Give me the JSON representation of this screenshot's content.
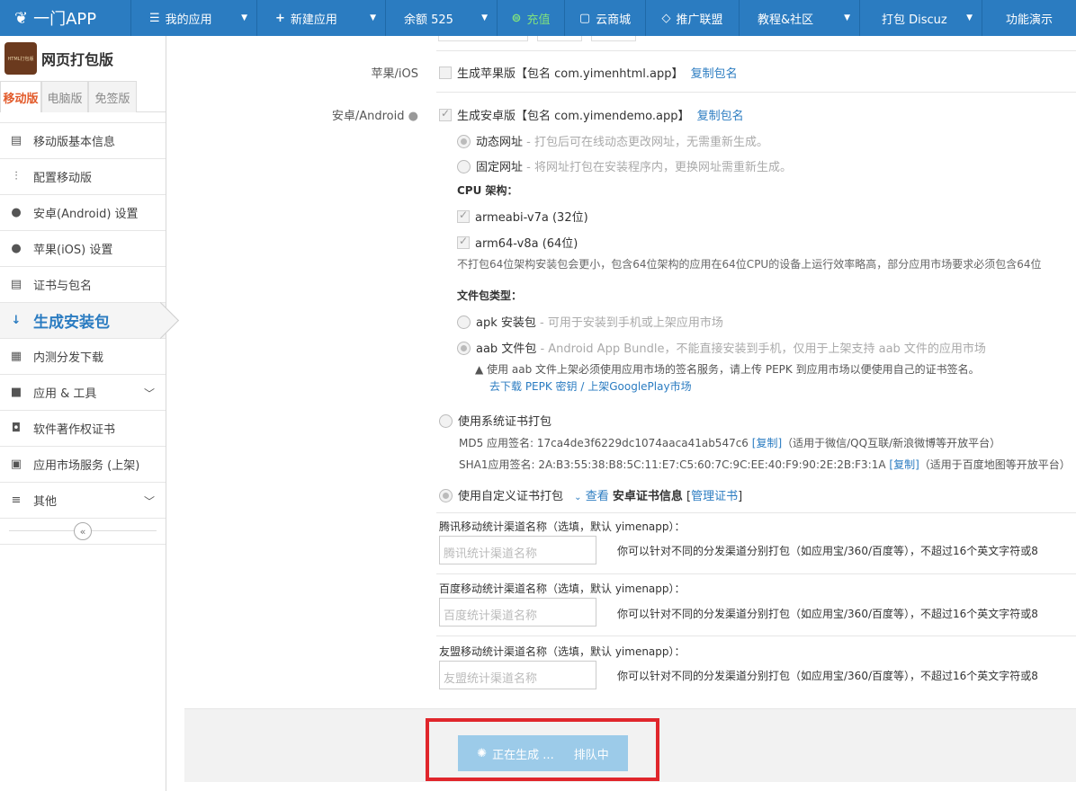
{
  "topbar": {
    "brand": "一门APP",
    "items": [
      {
        "label": "我的应用",
        "icon": "☰",
        "caret": true
      },
      {
        "label": "新建应用",
        "icon": "+",
        "caret": true
      },
      {
        "label": "余额 525",
        "icon": "",
        "caret": true
      },
      {
        "label": "充值",
        "icon": "⊜",
        "caret": false
      },
      {
        "label": "云商城",
        "icon": "▢",
        "caret": false
      },
      {
        "label": "推广联盟",
        "icon": "◇",
        "caret": false
      },
      {
        "label": "教程&社区",
        "icon": "",
        "caret": true
      },
      {
        "label": "打包 Discuz",
        "icon": "",
        "caret": true
      },
      {
        "label": "功能演示",
        "icon": "",
        "caret": false
      }
    ]
  },
  "sidebar": {
    "app_icon_text": "HTML打包版",
    "app_name": "网页打包版",
    "tabs": [
      "移动版",
      "电脑版",
      "免签版"
    ],
    "items": [
      {
        "label": "移动版基本信息",
        "icon": "▤"
      },
      {
        "label": "配置移动版",
        "icon": "⫶"
      },
      {
        "label": "安卓(Android) 设置",
        "icon": "●"
      },
      {
        "label": "苹果(iOS) 设置",
        "icon": ""
      },
      {
        "label": "证书与包名",
        "icon": "▤"
      },
      {
        "label": "生成安装包",
        "icon": "↓"
      },
      {
        "label": "内测分发下载",
        "icon": "▦"
      },
      {
        "label": "应用 & 工具",
        "icon": "■"
      },
      {
        "label": "软件著作权证书",
        "icon": "◘"
      },
      {
        "label": "应用市场服务 (上架)",
        "icon": "▣"
      },
      {
        "label": "其他",
        "icon": "≡"
      }
    ],
    "collapse": "«"
  },
  "main": {
    "ios_label": "苹果/iOS",
    "ios_checkbox": "生成苹果版【包名 com.yimenhtml.app】",
    "ios_copy": "复制包名",
    "android_label": "安卓/Android",
    "android_checkbox": "生成安卓版【包名 com.yimendemo.app】",
    "android_copy": "复制包名",
    "url_dynamic": "动态网址",
    "url_dynamic_hint": " - 打包后可在线动态更改网址，无需重新生成。",
    "url_fixed": "固定网址",
    "url_fixed_hint": " - 将网址打包在安装程序内，更换网址需重新生成。",
    "cpu_title": "CPU 架构：",
    "cpu1": "armeabi-v7a (32位)",
    "cpu2": "arm64-v8a (64位)",
    "cpu_note": "不打包64位架构安装包会更小，包含64位架构的应用在64位CPU的设备上运行效率略高，部分应用市场要求必须包含64位",
    "file_title": "文件包类型：",
    "apk": "apk 安装包",
    "apk_hint": " - 可用于安装到手机或上架应用市场",
    "aab": "aab 文件包",
    "aab_hint": " - Android App Bundle，不能直接安装到手机，仅用于上架支持 aab 文件的应用市场",
    "aab_warning": "使用 aab 文件上架必须使用应用市场的签名服务，请上传 PEPK 到应用市场以便使用自己的证书签名。",
    "pepk_link": "去下载 PEPK 密钥",
    "slash": " / ",
    "gplay_link": "上架GooglePlay市场",
    "sys_cert": "使用系统证书打包",
    "md5_label": "MD5 应用签名: 17ca4de3f6229dc1074aaca41ab547c6 ",
    "copy_link": "[复制]",
    "md5_note": "（适用于微信/QQ互联/新浪微博等开放平台）",
    "sha1_label": "SHA1应用签名: 2A:B3:55:38:B8:5C:11:E7:C5:60:7C:9C:EE:40:F9:90:2E:2B:F3:1A ",
    "sha1_note": "（适用于百度地图等开放平台）",
    "custom_cert": "使用自定义证书打包",
    "view_cert": "查看",
    "cert_info": "安卓证书信息",
    "manage_cert": "管理证书",
    "tencent_label": "腾讯移动统计渠道名称（选填，默认 yimenapp）：",
    "tencent_placeholder": "腾讯统计渠道名称",
    "baidu_label": "百度移动统计渠道名称（选填，默认 yimenapp）：",
    "baidu_placeholder": "百度统计渠道名称",
    "umeng_label": "友盟移动统计渠道名称（选填，默认 yimenapp）：",
    "umeng_placeholder": "友盟统计渠道名称",
    "channel_hint": "你可以针对不同的分发渠道分别打包（如应用宝/360/百度等），不超过16个英文字符或8",
    "generating": "正在生成 ...",
    "queued": "排队中"
  }
}
